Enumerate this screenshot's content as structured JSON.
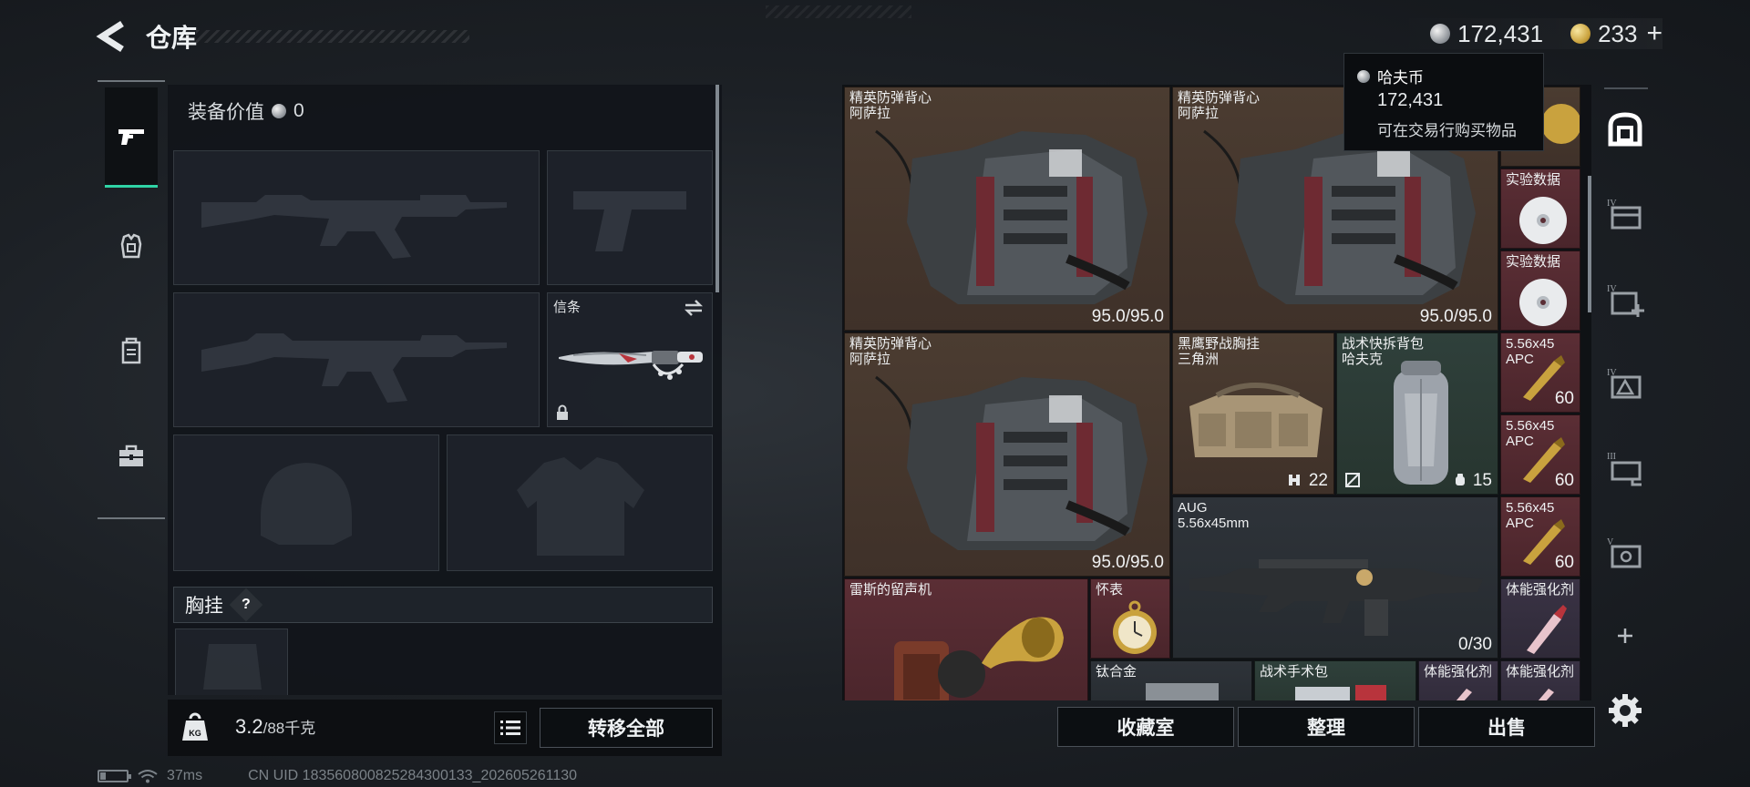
{
  "header": {
    "title": "仓库",
    "silver_amount": "172,431",
    "gold_amount": "233",
    "gold_plus": "+"
  },
  "colors": {
    "accent": "#2fd3a5",
    "rarity_brown": "#4b3c31",
    "rarity_red": "#5b2e35",
    "rarity_green": "#2f403b",
    "rarity_purple": "#3a3345"
  },
  "left_tabs": [
    {
      "icon": "pistol-icon",
      "active": true
    },
    {
      "icon": "armor-icon",
      "active": false
    },
    {
      "icon": "backpack-icon",
      "active": false
    },
    {
      "icon": "briefcase-icon",
      "active": false
    }
  ],
  "equipment": {
    "value_label": "装备价值",
    "value": "0",
    "melee_label": "信条",
    "chest_rig_label": "胸挂",
    "help": "?"
  },
  "weight": {
    "current": "3.2",
    "max_text": "/88千克",
    "transfer_all": "转移全部"
  },
  "tooltip": {
    "title": "哈夫币",
    "amount": "172,431",
    "desc": "可在交易行购买物品"
  },
  "stash_items": [
    {
      "name": "精英防弹背心",
      "sub": "阿萨拉",
      "value": "95.0/95.0"
    },
    {
      "name": "精英防弹背心",
      "sub": "阿萨拉",
      "value": "95.0/95.0"
    },
    {
      "name": "精英防弹背心",
      "sub": "阿萨拉",
      "value": "95.0/95.0"
    },
    {
      "name": "黑鹰野战胸挂",
      "sub": "三角洲",
      "value": "22"
    },
    {
      "name": "战术快拆背包",
      "sub": "哈夫克",
      "value": "15"
    },
    {
      "name": "AUG",
      "sub": "5.56x45mm",
      "value": "0/30"
    },
    {
      "name": "雷斯的留声机",
      "sub": "",
      "value": ""
    },
    {
      "name": "怀表",
      "sub": "",
      "value": ""
    },
    {
      "name": "实验数据",
      "sub": "",
      "value": ""
    },
    {
      "name": "实验数据",
      "sub": "",
      "value": ""
    },
    {
      "name": "5.56x45",
      "sub": "APC",
      "value": "60"
    },
    {
      "name": "5.56x45",
      "sub": "APC",
      "value": "60"
    },
    {
      "name": "5.56x45",
      "sub": "APC",
      "value": "60"
    },
    {
      "name": "体能强化剂",
      "sub": "",
      "value": ""
    },
    {
      "name": "钛合金",
      "sub": "",
      "value": ""
    },
    {
      "name": "战术手术包",
      "sub": "",
      "value": ""
    },
    {
      "name": "体能强化剂",
      "sub": "",
      "value": ""
    },
    {
      "name": "体能强化剂",
      "sub": "",
      "value": ""
    }
  ],
  "stash_buttons": {
    "collection": "收藏室",
    "sort": "整理",
    "sell": "出售"
  },
  "right_rail": [
    {
      "icon": "stash-home-icon",
      "label": ""
    },
    {
      "icon": "stash-page-iv-icon",
      "label": "IV"
    },
    {
      "icon": "stash-page-iv-add-icon",
      "label": "IV"
    },
    {
      "icon": "stash-page-iv-alert-icon",
      "label": "IV"
    },
    {
      "icon": "stash-page-iii-icon",
      "label": "III"
    },
    {
      "icon": "stash-page-v-icon",
      "label": "V"
    },
    {
      "icon": "add-icon",
      "label": "+"
    },
    {
      "icon": "settings-gear-icon",
      "label": ""
    }
  ],
  "status": {
    "ping": "37ms",
    "uid": "CN UID 1835608008252843001​33_202605261130",
    "battery_level": 0.2
  }
}
